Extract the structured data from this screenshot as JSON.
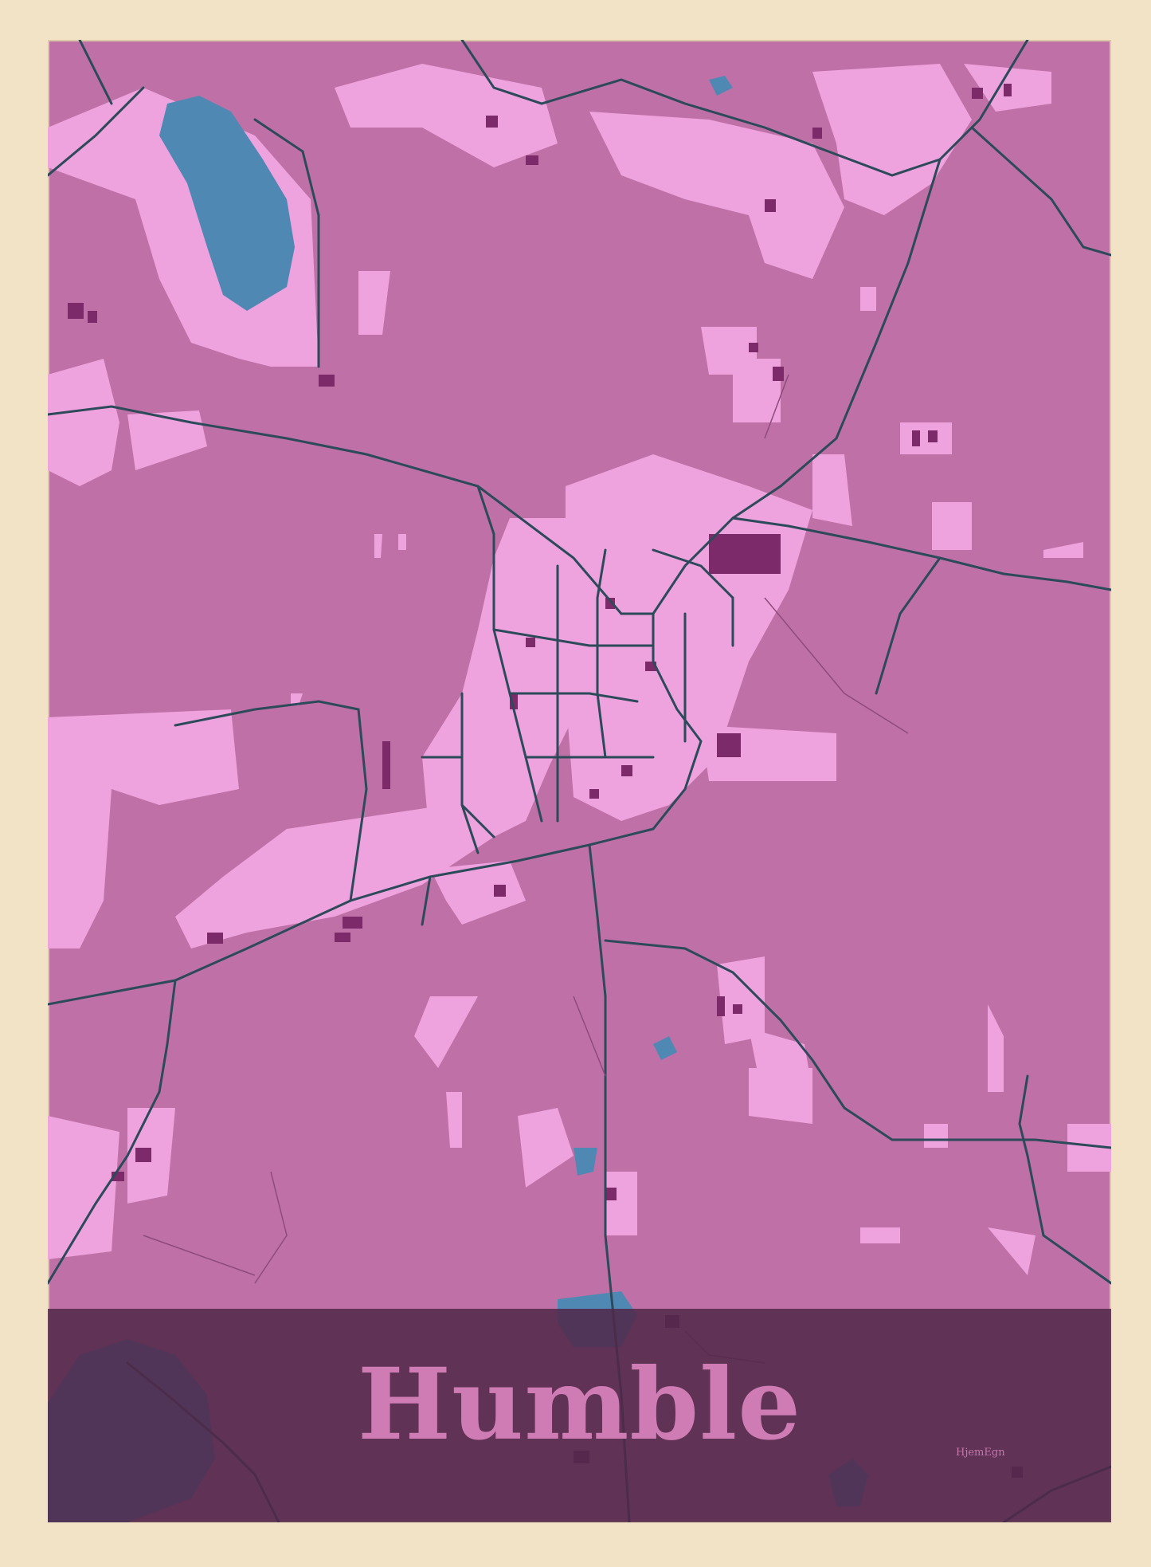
{
  "map": {
    "title": "Humble",
    "brand": "HjemEgn",
    "colors": {
      "frame": "#f2e3c6",
      "land": "#bf70a6",
      "built_area": "#eea2de",
      "buildings": "#7d2a6a",
      "roads": "#2c4a5a",
      "water": "#5088b4",
      "title_band": "#502848",
      "title_text": "#cf7bb4"
    }
  }
}
